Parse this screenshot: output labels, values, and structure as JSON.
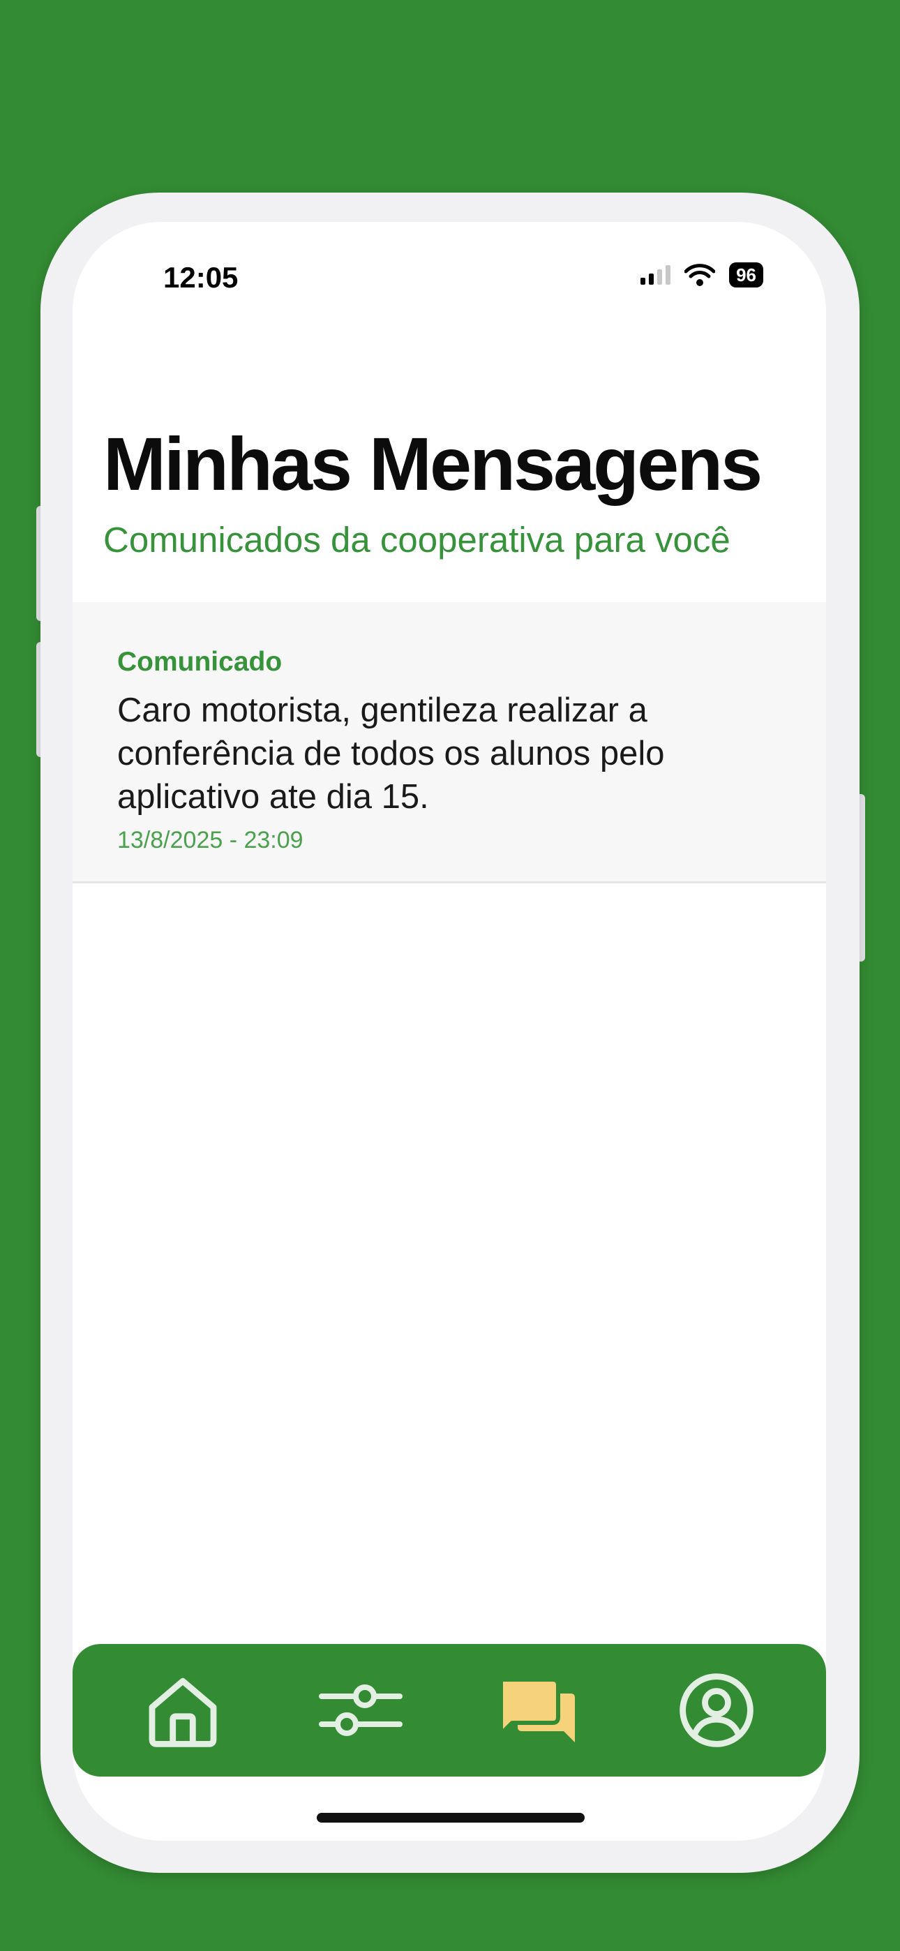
{
  "status_bar": {
    "time": "12:05",
    "battery": "96"
  },
  "header": {
    "title": "Minhas Mensagens",
    "subtitle": "Comunicados da cooperativa para você"
  },
  "messages": [
    {
      "category": "Comunicado",
      "text": "Caro motorista, gentileza realizar a conferência de todos os alunos pelo aplicativo ate dia 15.",
      "date": "13/8/2025 - 23:09"
    }
  ],
  "tab_bar": {
    "items": [
      {
        "icon": "home-icon",
        "active": false
      },
      {
        "icon": "sliders-icon",
        "active": false
      },
      {
        "icon": "chat-bubbles-icon",
        "active": true
      },
      {
        "icon": "user-circle-icon",
        "active": false
      }
    ]
  },
  "colors": {
    "background": "#338b33",
    "accent_green": "#36933a",
    "active_tab": "#f6d27a",
    "inactive_tab": "#e4efe4"
  }
}
